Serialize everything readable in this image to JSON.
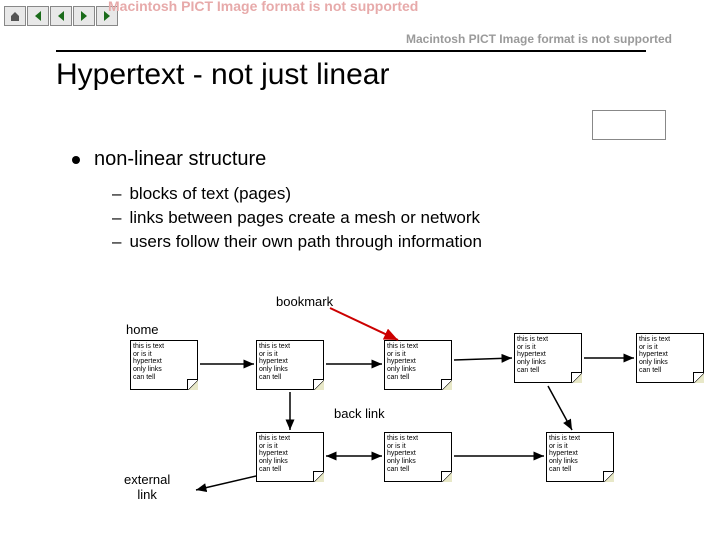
{
  "nav": {
    "home_icon": "home-icon",
    "prev_icon": "triangle-left-icon",
    "back_icon": "triangle-left-icon",
    "fwd_icon": "triangle-right-icon",
    "next_icon": "triangle-right-icon"
  },
  "ghost_left": "Macintosh PICT\nImage format\nis not supported",
  "ghost_right": "Macintosh PICT\nImage format\nis not supported",
  "title": "Hypertext - not just linear",
  "bullet": "non-linear structure",
  "subs": [
    "blocks of text (pages)",
    "links between pages create a mesh or network",
    "users follow their own path through information"
  ],
  "labels": {
    "bookmark": "bookmark",
    "home": "home",
    "backlink": "back link",
    "external": "external\nlink"
  },
  "note_text": "this is text\nor is it\nhypertext\nonly links\ncan tell",
  "colors": {
    "note_fill": "#ffffff",
    "note_corner": "#e8e8c8",
    "arrow_red": "#cc0000",
    "arrow_black": "#000000",
    "nav_green": "#1a6b1a"
  }
}
